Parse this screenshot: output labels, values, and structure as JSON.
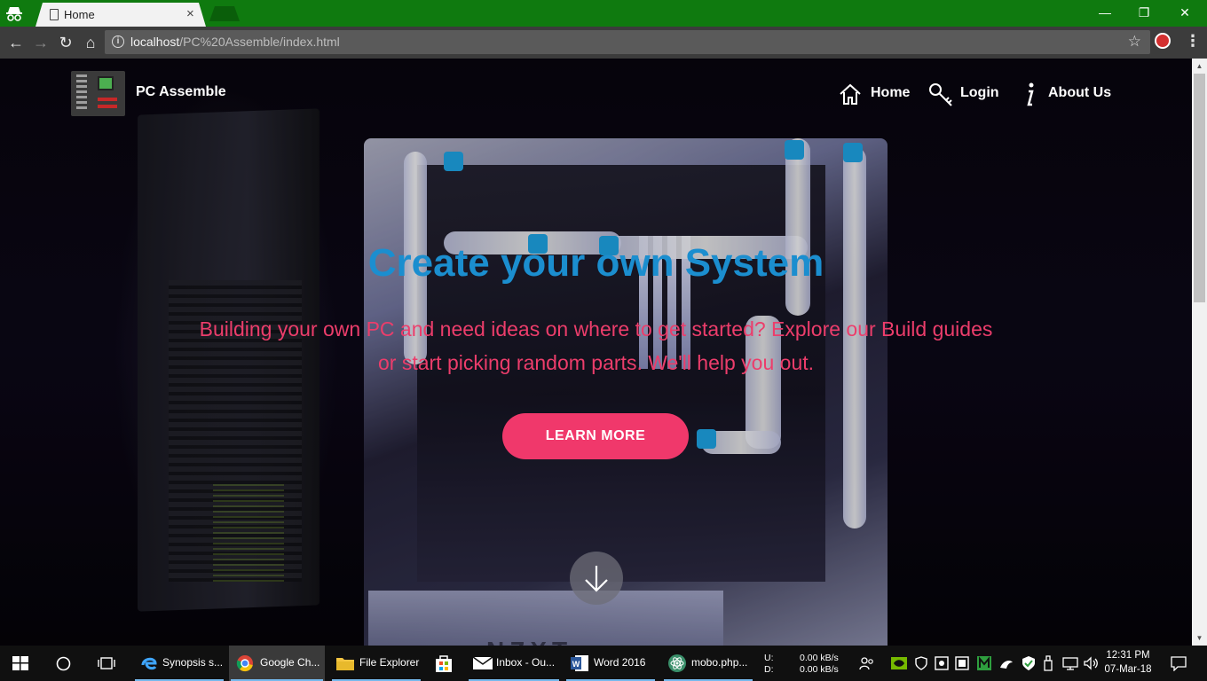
{
  "browser": {
    "tab_title": "Home",
    "url_host": "localhost",
    "url_path": "/PC%20Assemble/index.html",
    "window_controls": {
      "minimize": "—",
      "restore": "❐",
      "close": "✕"
    }
  },
  "site": {
    "brand": "PC Assemble",
    "nav": [
      {
        "label": "Home",
        "icon": "home-icon"
      },
      {
        "label": "Login",
        "icon": "key-icon"
      },
      {
        "label": "About Us",
        "icon": "info-icon"
      }
    ],
    "hero": {
      "title": "Create your own System",
      "subtitle": "Building your own PC and need ideas on where to get started? Explore our Build guides or start picking random parts. We'll help you out.",
      "cta": "LEARN MORE"
    },
    "colors": {
      "title": "#1b8ecf",
      "subtitle": "#ec3d6b",
      "cta": "#f0386b"
    }
  },
  "taskbar": {
    "apps": [
      {
        "label": "Synopsis s...",
        "icon": "edge-icon"
      },
      {
        "label": "Google Ch...",
        "icon": "chrome-icon",
        "active": true
      },
      {
        "label": "File Explorer",
        "icon": "folder-icon"
      },
      {
        "label": "",
        "icon": "store-icon"
      },
      {
        "label": "Inbox - Ou...",
        "icon": "mail-icon"
      },
      {
        "label": "Word 2016",
        "icon": "word-icon"
      },
      {
        "label": "mobo.php...",
        "icon": "atom-icon"
      }
    ],
    "net_upload_label": "U:",
    "net_download_label": "D:",
    "net_upload": "0.00 kB/s",
    "net_download": "0.00 kB/s",
    "time": "12:31 PM",
    "date": "07-Mar-18"
  }
}
